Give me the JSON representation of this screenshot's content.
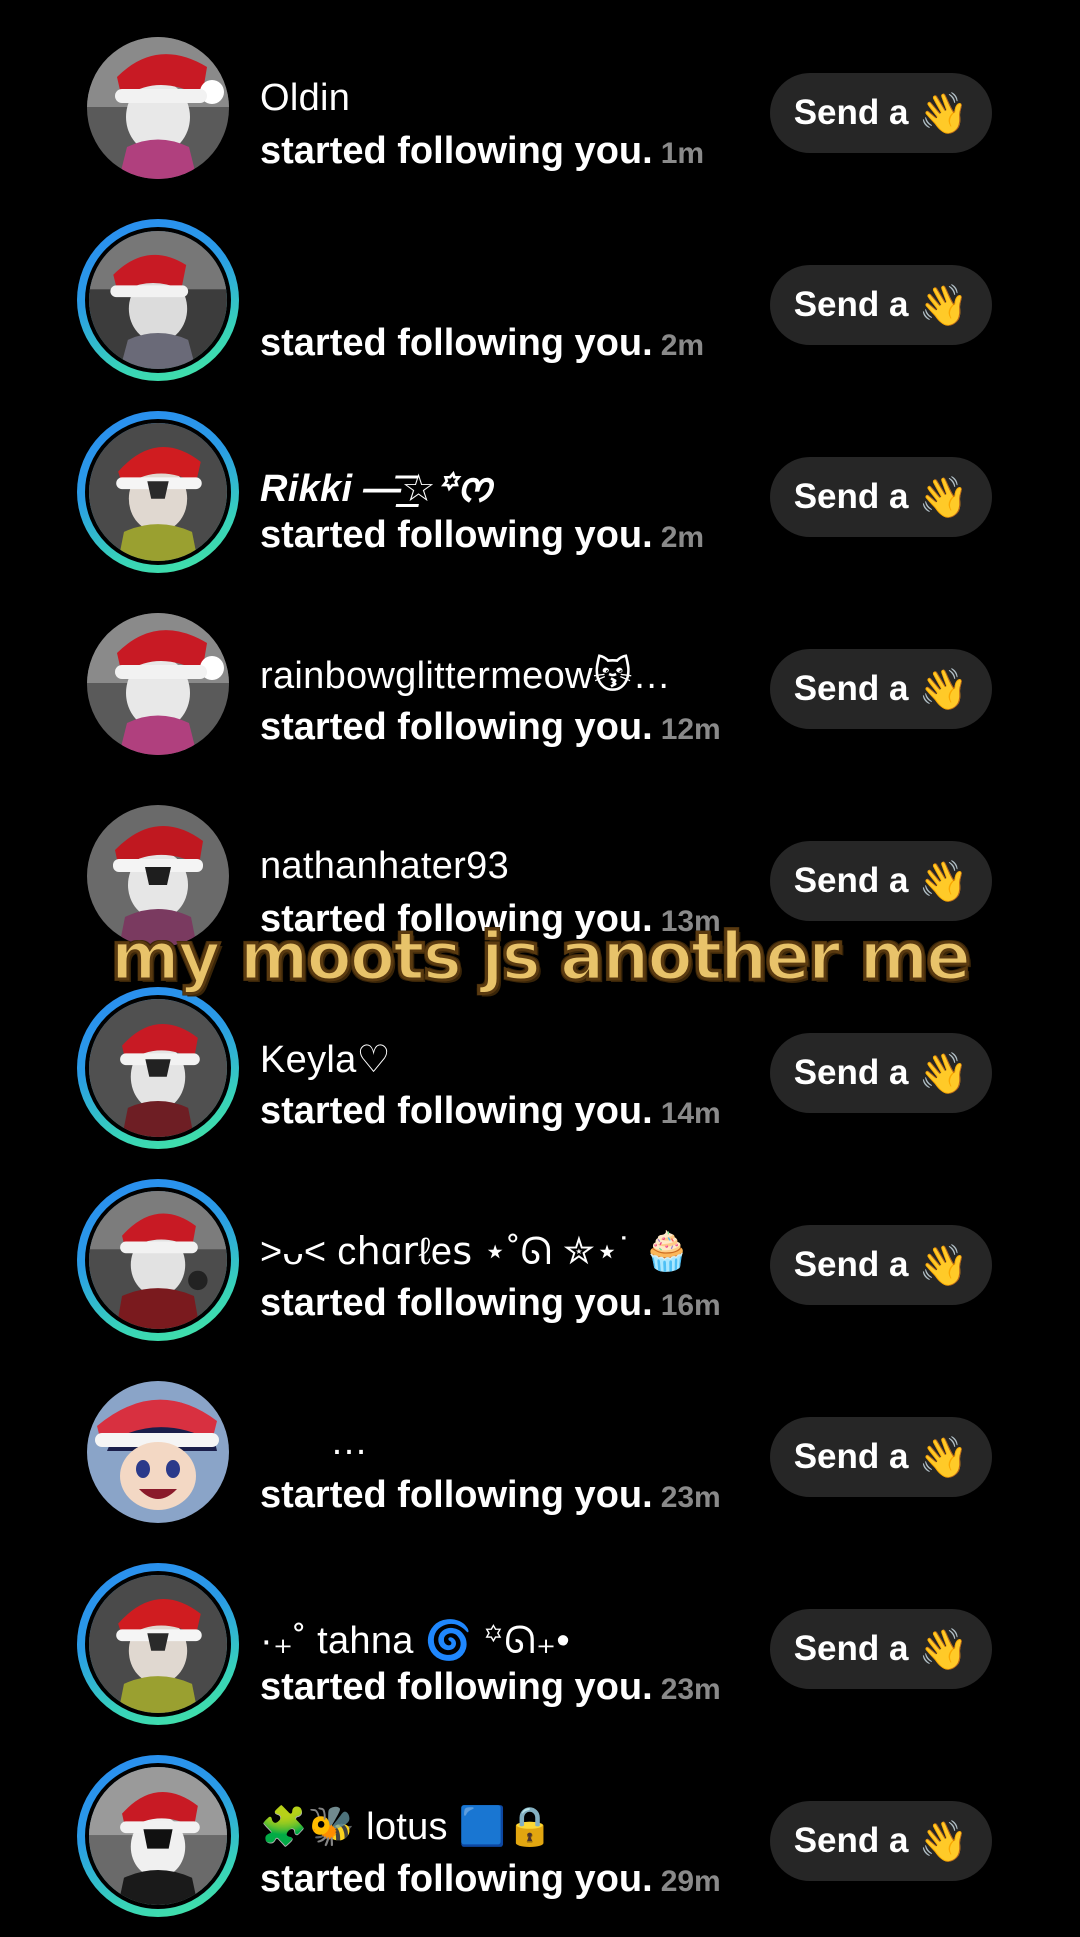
{
  "caption": "my moots js another me",
  "send_label": "Send a",
  "send_icon": "waving-hand-icon",
  "wave_glyph": "👋",
  "action_text": "started following you.",
  "colors": {
    "background": "#000000",
    "button_bg": "#262626",
    "time_text": "#8a8a8a",
    "story_ring_start": "#2a8cf2",
    "story_ring_end": "#45e6a0",
    "caption_fill": "#e8c36a"
  },
  "notifications": [
    {
      "username": "Oldin",
      "time": "1m",
      "story_ring": false
    },
    {
      "username": "",
      "time": "2m",
      "story_ring": true
    },
    {
      "username": "Rikki —͟͞͞☆꙳ᰔ",
      "time": "2m",
      "story_ring": true
    },
    {
      "username": "rainbowglittermeow😽…",
      "time": "12m",
      "story_ring": false
    },
    {
      "username": "nathanhater93",
      "time": "13m",
      "story_ring": false
    },
    {
      "username": "Keyla♡",
      "time": "14m",
      "story_ring": true
    },
    {
      "username": ">ᴗ< cհɑ𝗋ℓеꜱ ⋆˚ᘏ ✮⋆˙ 🧁",
      "time": "16m",
      "story_ring": true
    },
    {
      "username": "…",
      "time": "23m",
      "story_ring": false
    },
    {
      "username": "·₊˚ tahna 🌀 ꙳ᘏ₊•",
      "time": "23m",
      "story_ring": true
    },
    {
      "username": "🧩🐝 lotus 🟦🔒",
      "time": "29m",
      "story_ring": true
    }
  ]
}
